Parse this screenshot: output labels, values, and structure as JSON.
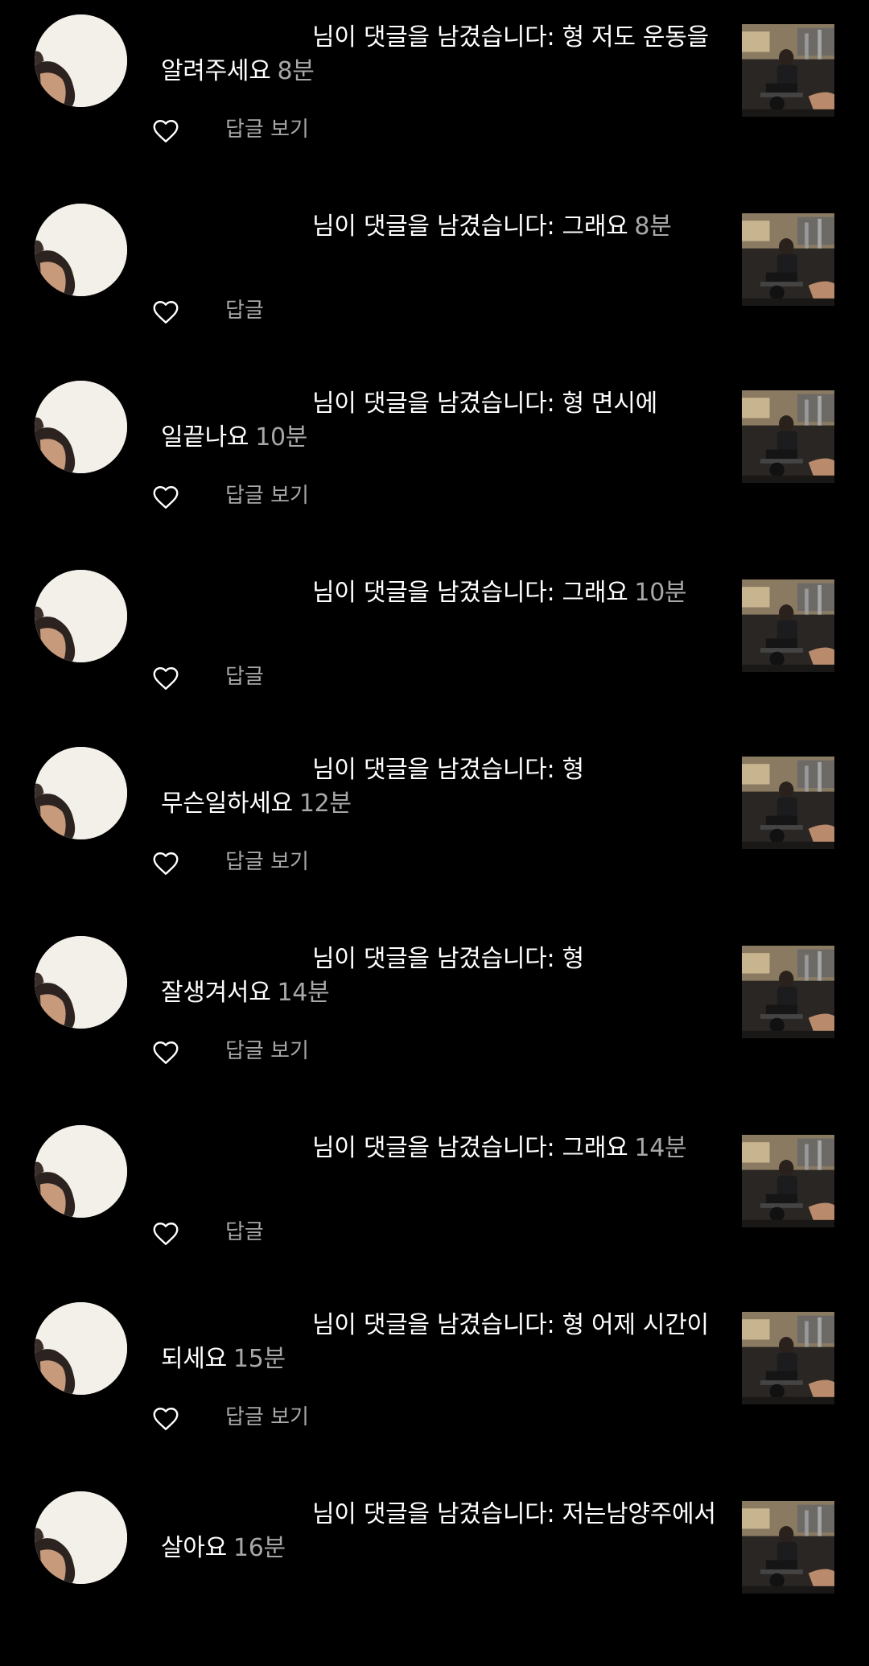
{
  "theme": {
    "background": "#000000",
    "text": "#ffffff",
    "secondary_text": "#a8a8a8"
  },
  "icons": {
    "like": "heart-outline-icon"
  },
  "notifications": [
    {
      "text": "님이 댓글을 남겼습니다: 형 저도 운동을 알려주세요",
      "time": "8분",
      "reply_label": "답글 보기"
    },
    {
      "text": "님이 댓글을 남겼습니다: 그래요",
      "time": "8분",
      "reply_label": "답글"
    },
    {
      "text": "님이 댓글을 남겼습니다: 형 면시에 일끝나요",
      "time": "10분",
      "reply_label": "답글 보기"
    },
    {
      "text": "님이 댓글을 남겼습니다: 그래요",
      "time": "10분",
      "reply_label": "답글"
    },
    {
      "text": "님이 댓글을 남겼습니다: 형 무슨일하세요",
      "time": "12분",
      "reply_label": "답글 보기"
    },
    {
      "text": "님이 댓글을 남겼습니다: 형 잘생겨서요",
      "time": "14분",
      "reply_label": "답글 보기"
    },
    {
      "text": "님이 댓글을 남겼습니다: 그래요",
      "time": "14분",
      "reply_label": "답글"
    },
    {
      "text": "님이 댓글을 남겼습니다: 형 어제 시간이 되세요",
      "time": "15분",
      "reply_label": "답글 보기"
    },
    {
      "text": "님이 댓글을 남겼습니다: 저는남양주에서 살아요",
      "time": "16분",
      "reply_label": ""
    }
  ]
}
